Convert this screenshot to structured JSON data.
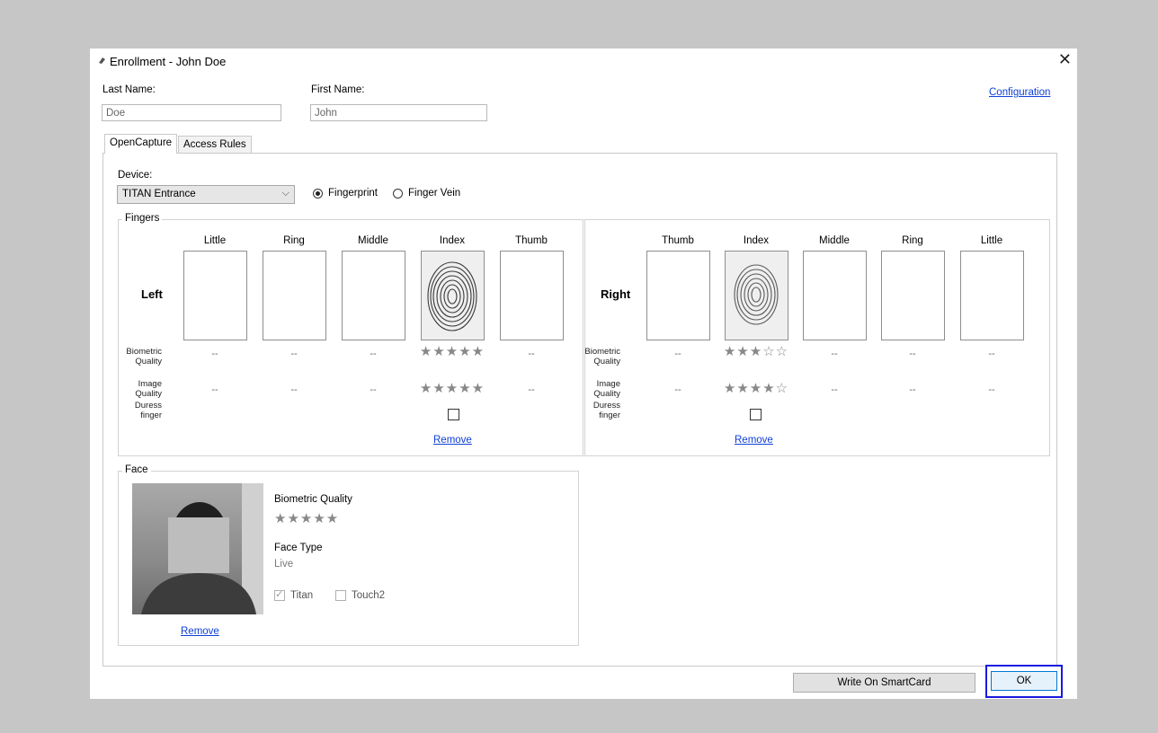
{
  "window": {
    "title": "Enrollment - John Doe"
  },
  "form": {
    "last_name_label": "Last Name:",
    "last_name_value": "Doe",
    "first_name_label": "First Name:",
    "first_name_value": "John",
    "configuration_link": "Configuration"
  },
  "tabs": [
    {
      "label": "OpenCapture"
    },
    {
      "label": "Access Rules"
    }
  ],
  "device": {
    "label": "Device:",
    "selected": "TITAN Entrance",
    "modes": [
      {
        "label": "Fingerprint",
        "selected": true
      },
      {
        "label": "Finger Vein",
        "selected": false
      }
    ]
  },
  "fingers": {
    "group_label": "Fingers",
    "row_labels": {
      "biometric": "Biometric Quality",
      "image": "Image Quality",
      "duress": "Duress finger"
    },
    "left": {
      "side_label": "Left",
      "columns": [
        {
          "name": "Little",
          "biometric": "--",
          "image": "--"
        },
        {
          "name": "Ring",
          "biometric": "--",
          "image": "--"
        },
        {
          "name": "Middle",
          "biometric": "--",
          "image": "--"
        },
        {
          "name": "Index",
          "biometric": "★★★★★",
          "image": "★★★★★",
          "biometric_rating": 5,
          "image_rating": 5,
          "remove": "Remove"
        },
        {
          "name": "Thumb",
          "biometric": "--",
          "image": "--"
        }
      ]
    },
    "right": {
      "side_label": "Right",
      "columns": [
        {
          "name": "Thumb",
          "biometric": "--",
          "image": "--"
        },
        {
          "name": "Index",
          "biometric": "★★★☆☆",
          "image": "★★★★☆",
          "biometric_rating": 3,
          "image_rating": 4,
          "remove": "Remove"
        },
        {
          "name": "Middle",
          "biometric": "--",
          "image": "--"
        },
        {
          "name": "Ring",
          "biometric": "--",
          "image": "--"
        },
        {
          "name": "Little",
          "biometric": "--",
          "image": "--"
        }
      ]
    }
  },
  "face": {
    "group_label": "Face",
    "biometric_quality_label": "Biometric Quality",
    "biometric_stars": "★★★★★",
    "biometric_rating": 5,
    "face_type_label": "Face Type",
    "face_type_value": "Live",
    "checks": [
      {
        "label": "Titan",
        "checked": true
      },
      {
        "label": "Touch2",
        "checked": false
      }
    ],
    "remove": "Remove"
  },
  "footer": {
    "write_smartcard": "Write On SmartCard",
    "ok": "OK"
  },
  "colors": {
    "link": "#1040d8",
    "focus_border": "#1a1ae0"
  }
}
